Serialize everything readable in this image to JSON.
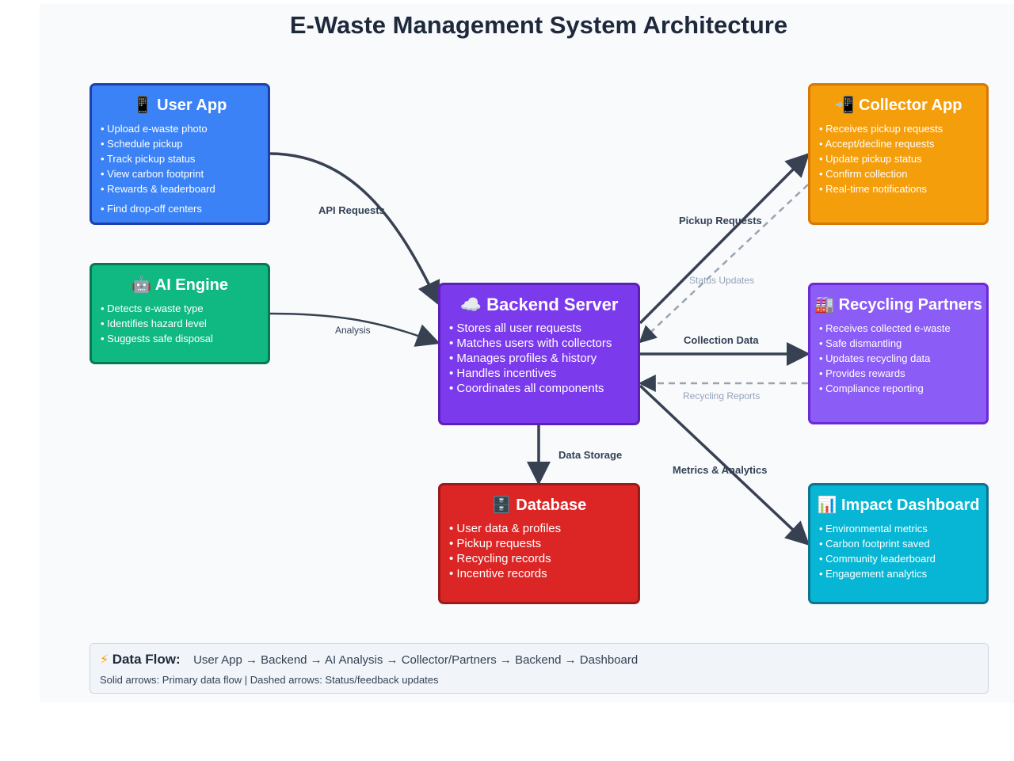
{
  "title": "E-Waste Management System Architecture",
  "colors": {
    "canvas": "#f8fafc",
    "arrow": "#374151",
    "dashed_arrow": "#9ca3af",
    "user_app": "#3b82f6",
    "ai_engine": "#10b981",
    "backend": "#7c3aed",
    "database": "#dc2626",
    "collector": "#f59e0b",
    "recycling": "#8b5cf6",
    "dashboard": "#06b6d4"
  },
  "nodes": {
    "user_app": {
      "icon": "mobile-phone-icon",
      "glyph": "📱",
      "title": "User App",
      "items": [
        "• Upload e-waste photo",
        "• Schedule pickup",
        "• Track pickup status",
        "• View carbon footprint",
        "• Rewards & leaderboard",
        "• Find drop-off centers"
      ]
    },
    "ai_engine": {
      "icon": "robot-icon",
      "glyph": "🤖",
      "title": "AI Engine",
      "items": [
        "• Detects e-waste type",
        "• Identifies hazard level",
        "• Suggests safe disposal"
      ]
    },
    "backend": {
      "icon": "cloud-icon",
      "glyph": "☁️",
      "title": "Backend Server",
      "items": [
        "• Stores all user requests",
        "• Matches users with collectors",
        "• Manages profiles & history",
        "• Handles incentives",
        "• Coordinates all components"
      ]
    },
    "database": {
      "icon": "file-cabinet-icon",
      "glyph": "🗄️",
      "title": "Database",
      "items": [
        "• User data & profiles",
        "• Pickup requests",
        "• Recycling records",
        "• Incentive records"
      ]
    },
    "collector": {
      "icon": "mobile-arrow-icon",
      "glyph": "📲",
      "title": "Collector App",
      "items": [
        "• Receives pickup requests",
        "• Accept/decline requests",
        "• Update pickup status",
        "• Confirm collection",
        "• Real-time notifications"
      ]
    },
    "recycling": {
      "icon": "factory-icon",
      "glyph": "🏭",
      "title": "Recycling Partners",
      "items": [
        "• Receives collected e-waste",
        "• Safe dismantling",
        "• Updates recycling data",
        "• Provides rewards",
        "• Compliance reporting"
      ]
    },
    "dashboard": {
      "icon": "bar-chart-icon",
      "glyph": "📊",
      "title": "Impact Dashboard",
      "items": [
        "• Environmental metrics",
        "• Carbon footprint saved",
        "• Community leaderboard",
        "• Engagement analytics"
      ]
    }
  },
  "edges": {
    "api_requests": "API Requests",
    "analysis": "Analysis",
    "pickup_requests": "Pickup Requests",
    "status_updates": "Status Updates",
    "collection_data": "Collection Data",
    "recycling_reports": "Recycling Reports",
    "data_storage": "Data Storage",
    "metrics_analytics": "Metrics & Analytics"
  },
  "legend": {
    "icon": "lightning-icon",
    "glyph": "⚡",
    "title": "Data Flow:",
    "flow": "User App → Backend → AI Analysis → Collector/Partners → Backend → Dashboard",
    "note": "Solid arrows: Primary data flow | Dashed arrows: Status/feedback updates"
  }
}
